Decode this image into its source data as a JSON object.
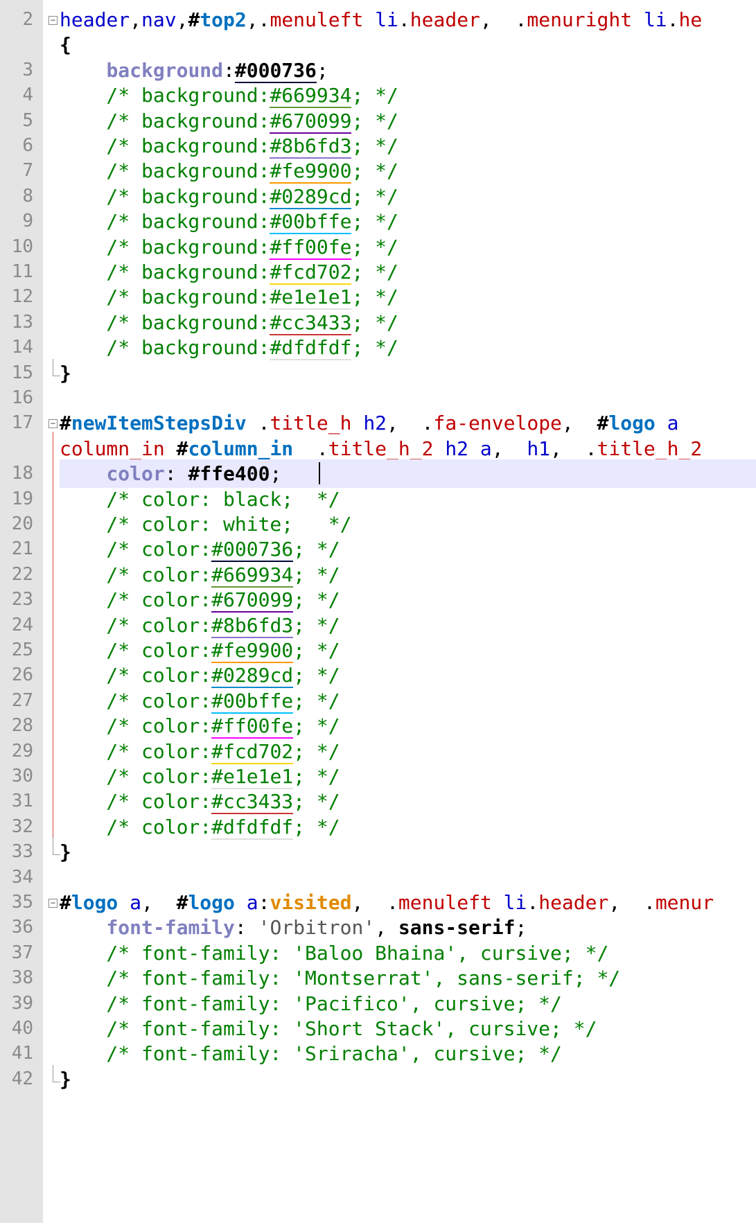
{
  "editor": {
    "lines": [
      {
        "n": "2",
        "fold": "start",
        "tokens": [
          [
            "header",
            "sel"
          ],
          [
            ",",
            "punct"
          ],
          [
            "nav",
            "sel"
          ],
          [
            ",",
            "punct"
          ],
          [
            "#",
            "hash"
          ],
          [
            "top2",
            "id"
          ],
          [
            ",",
            "punct"
          ],
          [
            ".",
            "punct"
          ],
          [
            "menuleft",
            "cls"
          ],
          [
            " ",
            "punct"
          ],
          [
            "li",
            "tag"
          ],
          [
            ".",
            "punct"
          ],
          [
            "header",
            "cls"
          ],
          [
            ",  ",
            "punct"
          ],
          [
            ".",
            "punct"
          ],
          [
            "menuright",
            "cls"
          ],
          [
            " ",
            "punct"
          ],
          [
            "li",
            "tag"
          ],
          [
            ".",
            "punct"
          ],
          [
            "he",
            "cls"
          ]
        ]
      },
      {
        "n": "",
        "tokens": [
          [
            "{",
            "brace"
          ]
        ]
      },
      {
        "n": "3",
        "tokens": [
          [
            "    ",
            "punct"
          ],
          [
            "background",
            "prop"
          ],
          [
            ":",
            "punct"
          ],
          [
            "#000736",
            "val",
            "#000736"
          ],
          [
            ";",
            "punct"
          ]
        ]
      },
      {
        "n": "4",
        "tokens": [
          [
            "    /* background:",
            "cmt"
          ],
          [
            "#669934",
            "cmt",
            "#669934"
          ],
          [
            "; */",
            "cmt"
          ]
        ]
      },
      {
        "n": "5",
        "tokens": [
          [
            "    /* background:",
            "cmt"
          ],
          [
            "#670099",
            "cmt",
            "#670099"
          ],
          [
            "; */",
            "cmt"
          ]
        ]
      },
      {
        "n": "6",
        "tokens": [
          [
            "    /* background:",
            "cmt"
          ],
          [
            "#8b6fd3",
            "cmt",
            "#8b6fd3"
          ],
          [
            "; */",
            "cmt"
          ]
        ]
      },
      {
        "n": "7",
        "tokens": [
          [
            "    /* background:",
            "cmt"
          ],
          [
            "#fe9900",
            "cmt",
            "#fe9900"
          ],
          [
            "; */",
            "cmt"
          ]
        ]
      },
      {
        "n": "8",
        "tokens": [
          [
            "    /* background:",
            "cmt"
          ],
          [
            "#0289cd",
            "cmt",
            "#0289cd"
          ],
          [
            "; */",
            "cmt"
          ]
        ]
      },
      {
        "n": "9",
        "tokens": [
          [
            "    /* background:",
            "cmt"
          ],
          [
            "#00bffe",
            "cmt",
            "#00bffe"
          ],
          [
            "; */",
            "cmt"
          ]
        ]
      },
      {
        "n": "10",
        "tokens": [
          [
            "    /* background:",
            "cmt"
          ],
          [
            "#ff00fe",
            "cmt",
            "#ff00fe"
          ],
          [
            "; */",
            "cmt"
          ]
        ]
      },
      {
        "n": "11",
        "tokens": [
          [
            "    /* background:",
            "cmt"
          ],
          [
            "#fcd702",
            "cmt",
            "#fcd702"
          ],
          [
            "; */",
            "cmt"
          ]
        ]
      },
      {
        "n": "12",
        "tokens": [
          [
            "    /* background:",
            "cmt"
          ],
          [
            "#e1e1e1",
            "cmt",
            "#e1e1e1"
          ],
          [
            "; */",
            "cmt"
          ]
        ]
      },
      {
        "n": "13",
        "tokens": [
          [
            "    /* background:",
            "cmt"
          ],
          [
            "#cc3433",
            "cmt",
            "#cc3433"
          ],
          [
            "; */",
            "cmt"
          ]
        ]
      },
      {
        "n": "14",
        "tokens": [
          [
            "    /* background:",
            "cmt"
          ],
          [
            "#dfdfdf",
            "cmt",
            "#dfdfdf"
          ],
          [
            "; */",
            "cmt"
          ]
        ]
      },
      {
        "n": "15",
        "fold": "end",
        "tokens": [
          [
            "}",
            "brace"
          ]
        ]
      },
      {
        "n": "16",
        "tokens": []
      },
      {
        "n": "17",
        "fold": "start",
        "tokens": [
          [
            "#",
            "hash"
          ],
          [
            "newItemStepsDiv",
            "id"
          ],
          [
            " ",
            "punct"
          ],
          [
            ".",
            "punct"
          ],
          [
            "title_h",
            "cls"
          ],
          [
            " ",
            "punct"
          ],
          [
            "h2",
            "tag"
          ],
          [
            ",  ",
            "punct"
          ],
          [
            ".",
            "punct"
          ],
          [
            "fa-envelope",
            "cls"
          ],
          [
            ",  ",
            "punct"
          ],
          [
            "#",
            "hash"
          ],
          [
            "logo",
            "id"
          ],
          [
            " ",
            "punct"
          ],
          [
            "a",
            "tag"
          ]
        ]
      },
      {
        "n": "",
        "tokens": [
          [
            "column_in",
            "cls"
          ],
          [
            " ",
            "punct"
          ],
          [
            "#",
            "hash"
          ],
          [
            "column_in",
            "id"
          ],
          [
            "  ",
            "punct"
          ],
          [
            ".",
            "punct"
          ],
          [
            "title_h_2",
            "cls"
          ],
          [
            " ",
            "punct"
          ],
          [
            "h2",
            "tag"
          ],
          [
            " ",
            "punct"
          ],
          [
            "a",
            "tag"
          ],
          [
            ",  ",
            "punct"
          ],
          [
            "h1",
            "tag"
          ],
          [
            ",  ",
            "punct"
          ],
          [
            ".",
            "punct"
          ],
          [
            "title_h_2",
            "cls"
          ]
        ]
      },
      {
        "n": "18",
        "current": true,
        "tokens": [
          [
            "    ",
            "punct"
          ],
          [
            "color",
            "prop"
          ],
          [
            ": ",
            "punct"
          ],
          [
            "#ffe400",
            "val"
          ],
          [
            ";",
            "punct"
          ]
        ]
      },
      {
        "n": "19",
        "tokens": [
          [
            "    /* color: black;  */",
            "cmt"
          ]
        ]
      },
      {
        "n": "20",
        "tokens": [
          [
            "    /* color: white;   */",
            "cmt"
          ]
        ]
      },
      {
        "n": "21",
        "tokens": [
          [
            "    /* color:",
            "cmt"
          ],
          [
            "#000736",
            "cmt",
            "#000736"
          ],
          [
            "; */",
            "cmt"
          ]
        ]
      },
      {
        "n": "22",
        "tokens": [
          [
            "    /* color:",
            "cmt"
          ],
          [
            "#669934",
            "cmt",
            "#669934"
          ],
          [
            "; */",
            "cmt"
          ]
        ]
      },
      {
        "n": "23",
        "tokens": [
          [
            "    /* color:",
            "cmt"
          ],
          [
            "#670099",
            "cmt",
            "#670099"
          ],
          [
            "; */",
            "cmt"
          ]
        ]
      },
      {
        "n": "24",
        "tokens": [
          [
            "    /* color:",
            "cmt"
          ],
          [
            "#8b6fd3",
            "cmt",
            "#8b6fd3"
          ],
          [
            "; */",
            "cmt"
          ]
        ]
      },
      {
        "n": "25",
        "tokens": [
          [
            "    /* color:",
            "cmt"
          ],
          [
            "#fe9900",
            "cmt",
            "#fe9900"
          ],
          [
            "; */",
            "cmt"
          ]
        ]
      },
      {
        "n": "26",
        "tokens": [
          [
            "    /* color:",
            "cmt"
          ],
          [
            "#0289cd",
            "cmt",
            "#0289cd"
          ],
          [
            "; */",
            "cmt"
          ]
        ]
      },
      {
        "n": "27",
        "tokens": [
          [
            "    /* color:",
            "cmt"
          ],
          [
            "#00bffe",
            "cmt",
            "#00bffe"
          ],
          [
            "; */",
            "cmt"
          ]
        ]
      },
      {
        "n": "28",
        "tokens": [
          [
            "    /* color:",
            "cmt"
          ],
          [
            "#ff00fe",
            "cmt",
            "#ff00fe"
          ],
          [
            "; */",
            "cmt"
          ]
        ]
      },
      {
        "n": "29",
        "tokens": [
          [
            "    /* color:",
            "cmt"
          ],
          [
            "#fcd702",
            "cmt",
            "#fcd702"
          ],
          [
            "; */",
            "cmt"
          ]
        ]
      },
      {
        "n": "30",
        "tokens": [
          [
            "    /* color:",
            "cmt"
          ],
          [
            "#e1e1e1",
            "cmt",
            "#e1e1e1"
          ],
          [
            "; */",
            "cmt"
          ]
        ]
      },
      {
        "n": "31",
        "tokens": [
          [
            "    /* color:",
            "cmt"
          ],
          [
            "#cc3433",
            "cmt",
            "#cc3433"
          ],
          [
            "; */",
            "cmt"
          ]
        ]
      },
      {
        "n": "32",
        "tokens": [
          [
            "    /* color:",
            "cmt"
          ],
          [
            "#dfdfdf",
            "cmt",
            "#dfdfdf"
          ],
          [
            "; */",
            "cmt"
          ]
        ]
      },
      {
        "n": "33",
        "fold": "end",
        "tokens": [
          [
            "}",
            "brace"
          ]
        ]
      },
      {
        "n": "34",
        "tokens": []
      },
      {
        "n": "35",
        "fold": "start",
        "tokens": [
          [
            "#",
            "hash"
          ],
          [
            "logo",
            "id"
          ],
          [
            " ",
            "punct"
          ],
          [
            "a",
            "tag"
          ],
          [
            ",  ",
            "punct"
          ],
          [
            "#",
            "hash"
          ],
          [
            "logo",
            "id"
          ],
          [
            " ",
            "punct"
          ],
          [
            "a",
            "tag"
          ],
          [
            ":",
            "punct"
          ],
          [
            "visited",
            "pseudo"
          ],
          [
            ",  ",
            "punct"
          ],
          [
            ".",
            "punct"
          ],
          [
            "menuleft",
            "cls"
          ],
          [
            " ",
            "punct"
          ],
          [
            "li",
            "tag"
          ],
          [
            ".",
            "punct"
          ],
          [
            "header",
            "cls"
          ],
          [
            ",  ",
            "punct"
          ],
          [
            ".",
            "punct"
          ],
          [
            "menur",
            "cls"
          ]
        ]
      },
      {
        "n": "36",
        "tokens": [
          [
            "    ",
            "punct"
          ],
          [
            "font-family",
            "prop"
          ],
          [
            ": ",
            "punct"
          ],
          [
            "'Orbitron'",
            "str"
          ],
          [
            ", ",
            "punct"
          ],
          [
            "sans-serif",
            "val"
          ],
          [
            ";",
            "punct"
          ]
        ]
      },
      {
        "n": "37",
        "tokens": [
          [
            "    /* font-family: 'Baloo Bhaina', cursive; */",
            "cmt"
          ]
        ]
      },
      {
        "n": "38",
        "tokens": [
          [
            "    /* font-family: 'Montserrat', sans-serif; */",
            "cmt"
          ]
        ]
      },
      {
        "n": "39",
        "tokens": [
          [
            "    /* font-family: 'Pacifico', cursive; */",
            "cmt"
          ]
        ]
      },
      {
        "n": "40",
        "tokens": [
          [
            "    /* font-family: 'Short Stack', cursive; */",
            "cmt"
          ]
        ]
      },
      {
        "n": "41",
        "tokens": [
          [
            "    /* font-family: 'Sriracha', cursive; */",
            "cmt"
          ]
        ]
      },
      {
        "n": "42",
        "fold": "end",
        "tokens": [
          [
            "}",
            "brace"
          ]
        ]
      }
    ]
  }
}
